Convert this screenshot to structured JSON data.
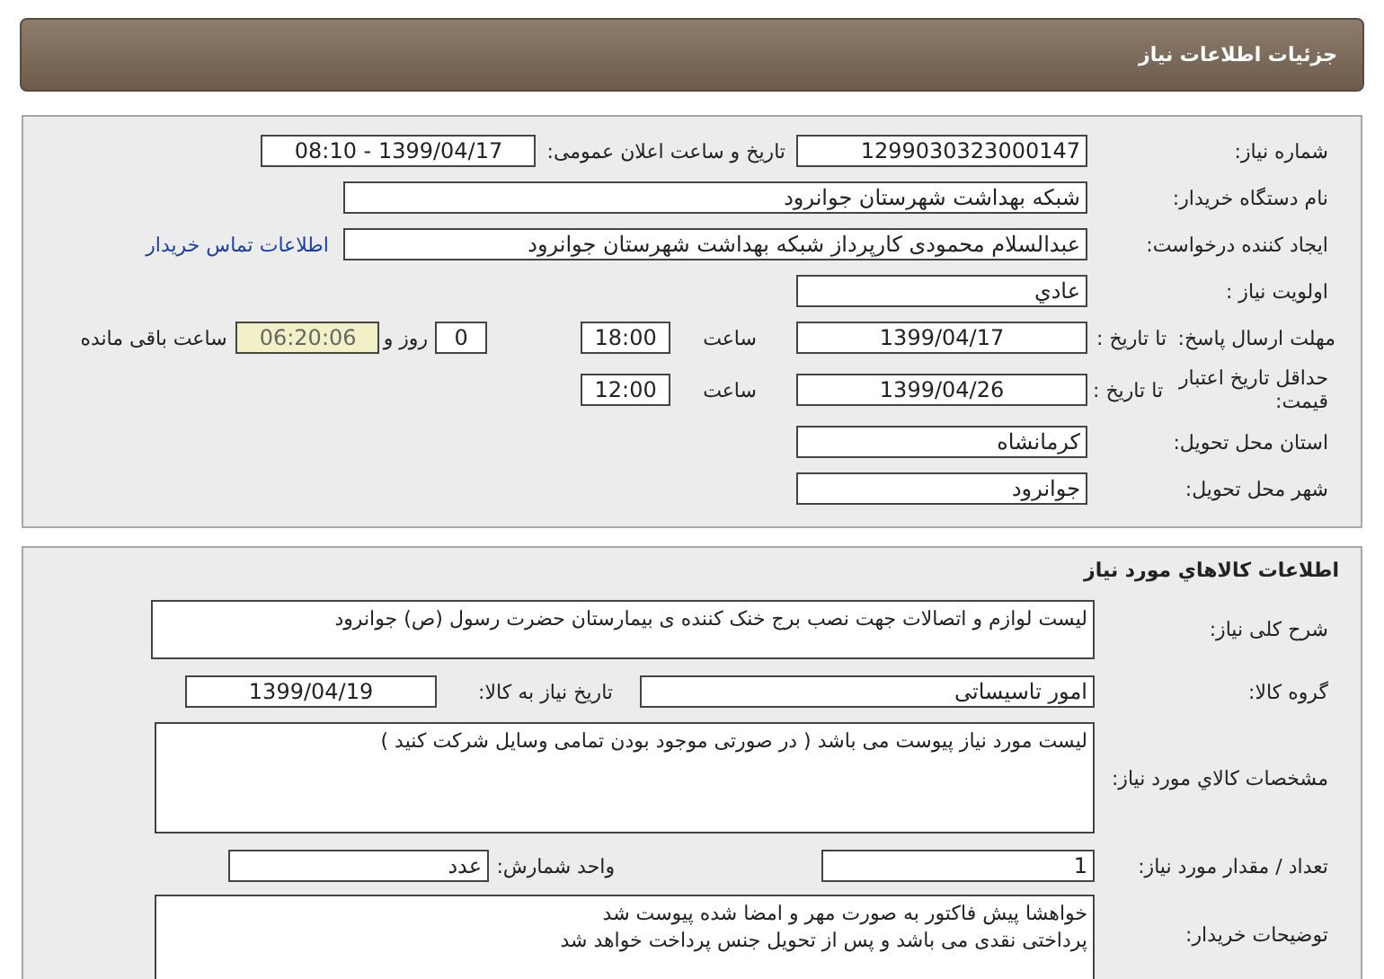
{
  "header": {
    "title": "جزئیات اطلاعات نیاز"
  },
  "details": {
    "need_number": {
      "label": "شماره نیاز:",
      "value": "1299030323000147"
    },
    "announce": {
      "label": "تاریخ و ساعت اعلان عمومی:",
      "value": "1399/04/17 - 08:10"
    },
    "buyer": {
      "label": "نام دستگاه خریدار:",
      "value": "شبکه بهداشت شهرستان جوانرود"
    },
    "requester": {
      "label": "ایجاد کننده درخواست:",
      "value": "عبدالسلام محمودی کارپرداز شبکه بهداشت شهرستان جوانرود",
      "link": "اطلاعات تماس خریدار"
    },
    "priority": {
      "label": "اولویت نیاز :",
      "value": "عادي"
    },
    "deadline": {
      "label": "مهلت ارسال پاسخ:",
      "to_date": "تا تاریخ :",
      "date": "1399/04/17",
      "time_label": "ساعت",
      "time": "18:00",
      "days": "0",
      "days_label": "روز و",
      "remaining": "06:20:06",
      "remaining_label": "ساعت باقی مانده"
    },
    "validity": {
      "label": "حداقل تاریخ اعتبار قیمت:",
      "to_date": "تا تاریخ :",
      "date": "1399/04/26",
      "time_label": "ساعت",
      "time": "12:00"
    },
    "province": {
      "label": "استان محل تحویل:",
      "value": "کرمانشاه"
    },
    "city": {
      "label": "شهر محل تحویل:",
      "value": "جوانرود"
    }
  },
  "goods": {
    "title": "اطلاعات کالاهاي مورد نیاز",
    "summary": {
      "label": "شرح کلی نیاز:",
      "value": "لیست لوازم و اتصالات جهت نصب برج خنک کننده ی بیمارستان حضرت رسول (ص) جوانرود"
    },
    "group": {
      "label": "گروه کالا:",
      "value": "امور تاسیساتی"
    },
    "need_date": {
      "label": "تاریخ نیاز به کالا:",
      "value": "1399/04/19"
    },
    "specs": {
      "label": "مشخصات کالاي مورد نیاز:",
      "value": "لیست مورد نیاز پیوست می باشد ( در صورتی موجود بودن تمامی وسایل شرکت کنید )"
    },
    "quantity": {
      "label": "تعداد / مقدار مورد نیاز:",
      "value": "1"
    },
    "unit": {
      "label": "واحد شمارش:",
      "value": "عدد"
    },
    "notes": {
      "label": "توضیحات خریدار:",
      "lines": [
        "خواهشا پیش فاکتور به صورت مهر و امضا شده پیوست شد",
        "پرداختی نقدی می باشد و پس از تحویل جنس پرداخت خواهد شد"
      ]
    }
  }
}
